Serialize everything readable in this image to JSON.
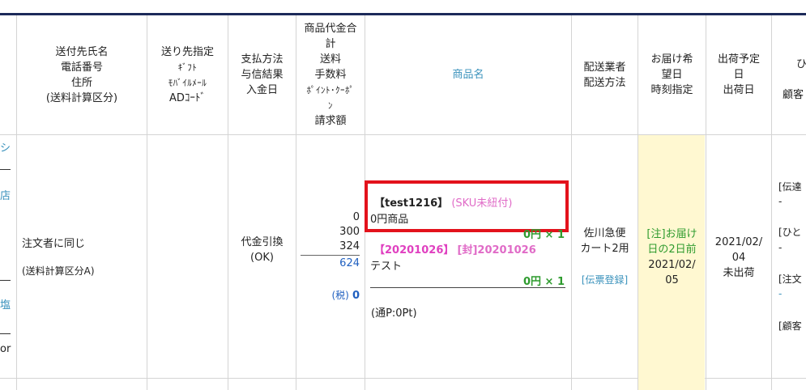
{
  "header": {
    "col_shipping": [
      "送付先氏名",
      "電話番号",
      "住所",
      "(送料計算区分)"
    ],
    "col_destination": [
      "送り先指定",
      "ｷﾞﾌﾄ",
      "ﾓﾊﾞｲﾙﾒｰﾙ",
      "ADｺｰﾄﾞ"
    ],
    "col_payment": [
      "支払方法",
      "与信結果",
      "入金日"
    ],
    "col_amount": [
      "商品代金合",
      "計",
      "送料",
      "手数料",
      "ﾎﾟｲﾝﾄ･ｸｰﾎﾟ",
      "ﾝ",
      "請求額"
    ],
    "col_product": "商品名",
    "col_carrier": [
      "配送業者",
      "配送方法"
    ],
    "col_delivery": [
      "お届け希",
      "望日",
      "時刻指定"
    ],
    "col_ship": [
      "出荷予定",
      "日",
      "出荷日"
    ],
    "col_right": [
      "ひ",
      "顧客"
    ]
  },
  "row": {
    "left_fragments": [
      "シ",
      "店",
      "塩",
      "or"
    ],
    "shipping": {
      "recipient": "注文者に同じ",
      "calc_class": "(送料計算区分A)"
    },
    "payment": {
      "method": "代金引換",
      "credit": "(OK)"
    },
    "amount": {
      "goods": "0",
      "shipping": "300",
      "fee": "324",
      "total": "624",
      "tax_label": "(税)",
      "tax_value": "0"
    },
    "product1": {
      "code": "【test1216】",
      "sku_note": "(SKU未紐付)",
      "name": "0円商品",
      "price_qty": "0円 × 1"
    },
    "product2": {
      "code": "【20201026】",
      "bundle": "[封]20201026",
      "name": "テスト",
      "price_qty": "0円 × 1"
    },
    "points": "(通P:0Pt)",
    "carrier": {
      "name1": "佐川急便",
      "name2": "カート2用",
      "slip_link": "[伝票登録]"
    },
    "delivery": {
      "note1": "[注]お届け",
      "note2": "日の2日前",
      "date1": "2021/02/",
      "date2": "05"
    },
    "ship": {
      "date1": "2021/02/",
      "date2": "04",
      "status": "未出荷"
    },
    "right_fragments": [
      "[伝達",
      "-",
      "[ひと",
      "-",
      "[注文",
      "-",
      "[顧客"
    ]
  }
}
